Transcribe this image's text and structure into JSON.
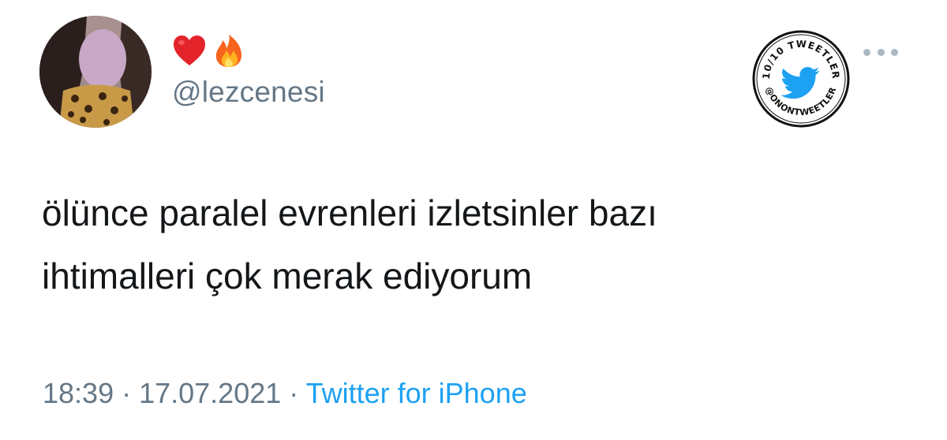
{
  "profile": {
    "display_name_emojis": [
      "heart-emoji",
      "fire-emoji"
    ],
    "handle": "@lezcenesi"
  },
  "badge": {
    "top_text": "10/10 TWEETLER",
    "bottom_text": "@ONONTWEETLER",
    "icon": "twitter-bird-icon"
  },
  "tweet": {
    "line1": "ölünce paralel evrenleri izletsinler bazı",
    "line2": "ihtimalleri çok merak ediyorum"
  },
  "meta": {
    "time": "18:39",
    "sep1": " · ",
    "date": "17.07.2021",
    "sep2": " · ",
    "source": "Twitter for iPhone"
  },
  "colors": {
    "text": "#14171a",
    "secondary": "#657786",
    "link": "#1da1f2",
    "twitter_blue": "#1da1f2"
  }
}
